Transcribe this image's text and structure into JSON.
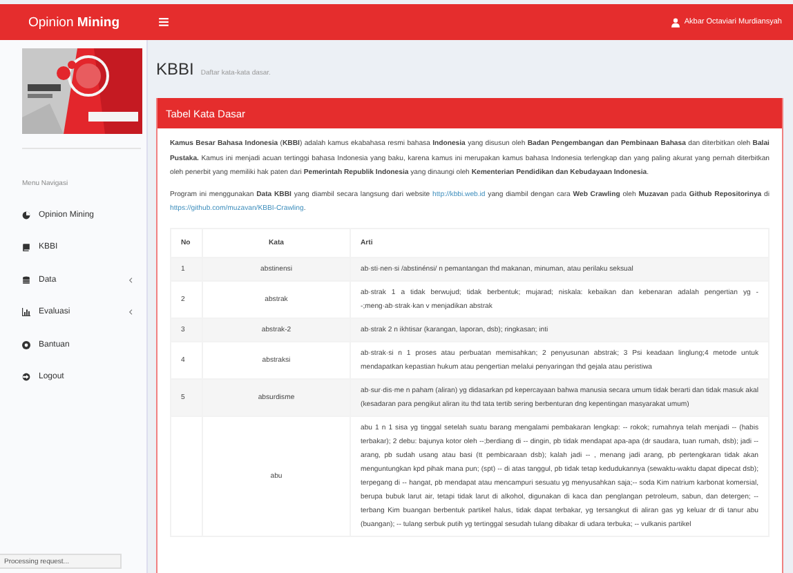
{
  "header": {
    "brand": [
      {
        "text": "Opinion",
        "kind": "text"
      },
      {
        "text": " Mining",
        "kind": "bold"
      }
    ],
    "user": "Akbar Octaviari Murdiansyah"
  },
  "sidebar": {
    "heading": "Menu Navigasi",
    "items": [
      {
        "label": "Opinion Mining",
        "kind": "pie",
        "has_children": false
      },
      {
        "label": "KBBI",
        "kind": "book",
        "has_children": false
      },
      {
        "label": "Data",
        "kind": "database",
        "has_children": true
      },
      {
        "label": "Evaluasi",
        "kind": "chart",
        "has_children": true
      },
      {
        "label": "Bantuan",
        "kind": "help",
        "has_children": false
      },
      {
        "label": "Logout",
        "kind": "logout",
        "has_children": false
      }
    ]
  },
  "page": {
    "title": "KBBI",
    "subtitle": "Daftar kata-kata dasar."
  },
  "panel": {
    "title": "Tabel Kata Dasar",
    "paragraphs": [
      [
        {
          "text": "Kamus Besar Bahasa Indonesia",
          "kind": "bold"
        },
        {
          "text": " (",
          "kind": "text"
        },
        {
          "text": "KBBI",
          "kind": "bold"
        },
        {
          "text": ") adalah kamus ekabahasa resmi bahasa ",
          "kind": "text"
        },
        {
          "text": "Indonesia",
          "kind": "bold"
        },
        {
          "text": " yang disusun oleh ",
          "kind": "text"
        },
        {
          "text": "Badan Pengembangan dan Pembinaan Bahasa",
          "kind": "bold"
        },
        {
          "text": " dan diterbitkan oleh ",
          "kind": "text"
        },
        {
          "text": "Balai Pustaka.",
          "kind": "bold"
        },
        {
          "text": " Kamus ini menjadi acuan tertinggi bahasa Indonesia yang baku, karena kamus ini merupakan kamus bahasa Indonesia terlengkap dan yang paling akurat yang pernah diterbitkan oleh penerbit yang memiliki hak paten dari ",
          "kind": "text"
        },
        {
          "text": "Pemerintah Republik Indonesia",
          "kind": "bold"
        },
        {
          "text": " yang dinaungi oleh ",
          "kind": "text"
        },
        {
          "text": "Kementerian Pendidikan dan Kebudayaan Indonesia",
          "kind": "bold"
        },
        {
          "text": ".",
          "kind": "text"
        }
      ],
      [
        {
          "text": "Program ini menggunakan ",
          "kind": "text"
        },
        {
          "text": "Data KBBI",
          "kind": "bold"
        },
        {
          "text": " yang diambil secara langsung dari website ",
          "kind": "text"
        },
        {
          "text": "http://kbbi.web.id",
          "kind": "link"
        },
        {
          "text": " yang diambil dengan cara ",
          "kind": "text"
        },
        {
          "text": "Web Crawling",
          "kind": "bold"
        },
        {
          "text": " oleh ",
          "kind": "text"
        },
        {
          "text": "Muzavan",
          "kind": "bold"
        },
        {
          "text": " pada ",
          "kind": "text"
        },
        {
          "text": "Github Repositorinya",
          "kind": "bold"
        },
        {
          "text": " di ",
          "kind": "text"
        },
        {
          "text": "https://github.com/muzavan/KBBI-Crawling",
          "kind": "link"
        },
        {
          "text": ".",
          "kind": "text"
        }
      ]
    ],
    "table": {
      "columns": [
        "No",
        "Kata",
        "Arti"
      ],
      "rows": [
        {
          "no": "1",
          "kata": "abstinensi",
          "arti": "ab·sti·nen·si /abstinénsi/ n pemantangan thd makanan, minuman, atau perilaku seksual"
        },
        {
          "no": "2",
          "kata": "abstrak",
          "arti": "ab·strak 1 a tidak berwujud; tidak berbentuk; mujarad; niskala: kebaikan dan kebenaran adalah pengertian yg --;meng·ab·strak·kan v menjadikan abstrak"
        },
        {
          "no": "3",
          "kata": "abstrak-2",
          "arti": "ab·strak 2 n ikhtisar (karangan, laporan, dsb); ringkasan; inti"
        },
        {
          "no": "4",
          "kata": "abstraksi",
          "arti": "ab·strak·si n 1 proses atau perbuatan memisahkan; 2 penyusunan abstrak; 3 Psi keadaan linglung;4 metode untuk mendapatkan kepastian hukum atau pengertian melalui penyaringan thd gejala atau peristiwa"
        },
        {
          "no": "5",
          "kata": "absurdisme",
          "arti": "ab·sur·dis·me n paham (aliran) yg didasarkan pd kepercayaan bahwa manusia secara umum tidak berarti dan tidak masuk akal (kesadaran para pengikut aliran itu thd tata tertib sering berbenturan dng kepentingan masyarakat umum)"
        },
        {
          "kata": "abu",
          "arti": "abu 1 n 1 sisa yg tinggal setelah suatu barang mengalami pembakaran lengkap: -- rokok; rumahnya telah menjadi -- (habis terbakar); 2 debu: bajunya kotor oleh --;berdiang di -- dingin, pb tidak mendapat apa-apa (dr saudara, tuan rumah, dsb); jadi -- arang, pb sudah usang atau basi (tt pembicaraan dsb); kalah jadi -- , menang jadi arang, pb pertengkaran tidak akan menguntungkan kpd pihak mana pun; (spt) -- di atas tanggul, pb tidak tetap kedudukannya (sewaktu-waktu dapat dipecat dsb); terpegang di -- hangat, pb mendapat atau mencampuri sesuatu yg menyusahkan saja;-- soda Kim natrium karbonat komersial, berupa bubuk larut air, tetapi tidak larut di alkohol, digunakan di kaca dan penglangan petroleum, sabun, dan detergen; -- terbang Kim buangan berbentuk partikel halus, tidak dapat terbakar, yg tersangkut di aliran gas yg keluar dr di tanur abu (buangan); -- tulang serbuk putih yg tertinggal sesudah tulang dibakar di udara terbuka; -- vulkanis partikel"
        }
      ]
    }
  },
  "status_bar": "Processing request..."
}
